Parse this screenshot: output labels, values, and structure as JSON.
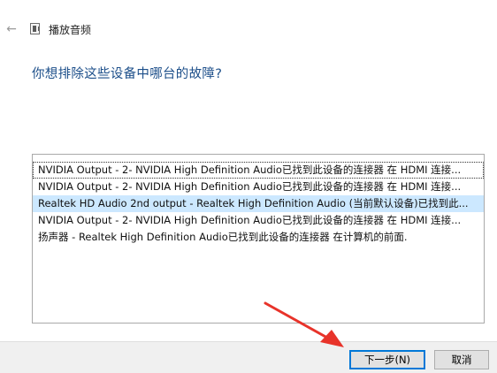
{
  "window": {
    "title": "播放音频",
    "back_icon": "back-arrow-icon",
    "app_icon": "audio-troubleshooter-icon"
  },
  "main": {
    "heading": "你想排除这些设备中哪台的故障?"
  },
  "devices": [
    "NVIDIA Output - 2- NVIDIA High Definition Audio已找到此设备的连接器 在 HDMI 连接...",
    "NVIDIA Output - 2- NVIDIA High Definition Audio已找到此设备的连接器 在 HDMI 连接...",
    "Realtek HD Audio 2nd output - Realtek High Definition Audio (当前默认设备)已找到此...",
    "NVIDIA Output - 2- NVIDIA High Definition Audio已找到此设备的连接器 在 HDMI 连接...",
    "扬声器 - Realtek High Definition Audio已找到此设备的连接器 在计算机的前面."
  ],
  "selected_device_index": 2,
  "footer": {
    "next_label": "下一步(N)",
    "cancel_label": "取消"
  },
  "colors": {
    "heading": "#1d4f8a",
    "selection": "#cce8ff",
    "annotation_arrow": "#e8332a"
  }
}
